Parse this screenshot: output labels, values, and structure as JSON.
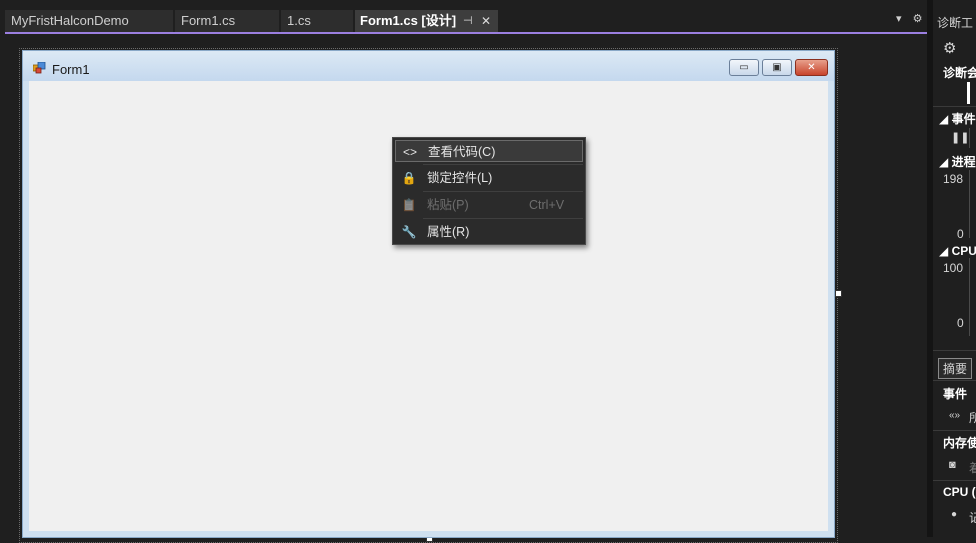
{
  "tabs": [
    {
      "label": "MyFristHalconDemo",
      "active": false
    },
    {
      "label": "Form1.cs",
      "active": false
    },
    {
      "label": "1.cs",
      "active": false
    },
    {
      "label": "Form1.cs [设计]",
      "active": true
    }
  ],
  "tab_icons": {
    "pin": "⊣",
    "close": "✕",
    "dropdown": "▾",
    "settings": "⚙"
  },
  "form": {
    "title": "Form1",
    "buttons": {
      "minimize": "▭",
      "maximize": "▣",
      "close": "✕"
    }
  },
  "context_menu": {
    "items": [
      {
        "icon": "<>",
        "label": "查看代码(C)",
        "shortcut": "",
        "enabled": true,
        "hover": true
      },
      {
        "icon": "🔒",
        "label": "锁定控件(L)",
        "shortcut": "",
        "enabled": true,
        "hover": false
      },
      {
        "icon": "📋",
        "label": "粘贴(P)",
        "shortcut": "Ctrl+V",
        "enabled": false,
        "hover": false
      },
      {
        "icon": "🔧",
        "label": "属性(R)",
        "shortcut": "",
        "enabled": true,
        "hover": false
      }
    ]
  },
  "diagnostics": {
    "title": "诊断工",
    "session_label": "诊断会",
    "events_header": "事件",
    "process_header": "进程",
    "process_max": "198",
    "process_min": "0",
    "cpu_header": "CPU",
    "cpu_max": "100",
    "cpu_min": "0",
    "summary_tab": "摘要",
    "events_label": "事件",
    "events_item": "所",
    "memory_label": "内存使",
    "memory_item": "着",
    "cpu_label": "CPU (",
    "cpu_item": "记"
  },
  "colors": {
    "accent": "#9b7fe0",
    "form_bg": "#f0f0f0",
    "menu_bg": "#2b2b2b"
  }
}
